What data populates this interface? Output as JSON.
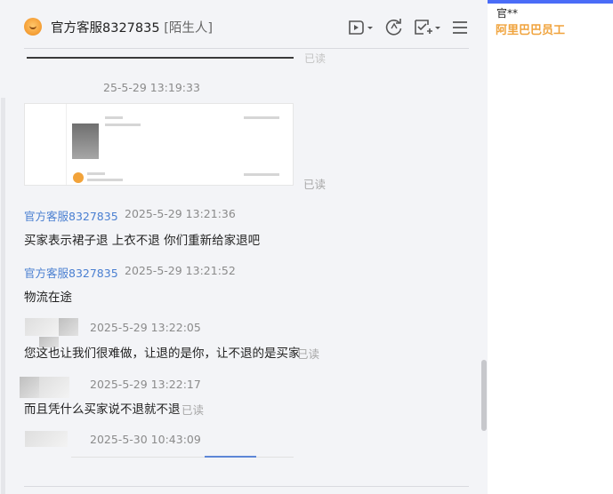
{
  "header": {
    "title": "官方客服8327835",
    "tag": "[陌生人]"
  },
  "messages": [
    {
      "top_faint": "已读"
    },
    {
      "timestamp": "25-5-29 13:19:33",
      "read": "已读"
    },
    {
      "sender": "官方客服8327835",
      "timestamp": "2025-5-29 13:21:36",
      "text": "买家表示裙子退 上衣不退 你们重新给家退吧"
    },
    {
      "sender": "官方客服8327835",
      "timestamp": "2025-5-29 13:21:52",
      "text": "物流在途"
    },
    {
      "timestamp": "2025-5-29 13:22:05",
      "text": "您这也让我们很难做，让退的是你，让不退的是买家",
      "read": "已读"
    },
    {
      "timestamp": "2025-5-29 13:22:17",
      "text": "而且凭什么买家说不退就不退",
      "read": "已读"
    },
    {
      "timestamp": "2025-5-30 10:43:09"
    }
  ],
  "side": {
    "name": "官**",
    "org": "阿里巴巴员工"
  },
  "colors": {
    "accent": "#4a7fd1",
    "org": "#f0a33c",
    "bar": "#4a6cf7"
  }
}
